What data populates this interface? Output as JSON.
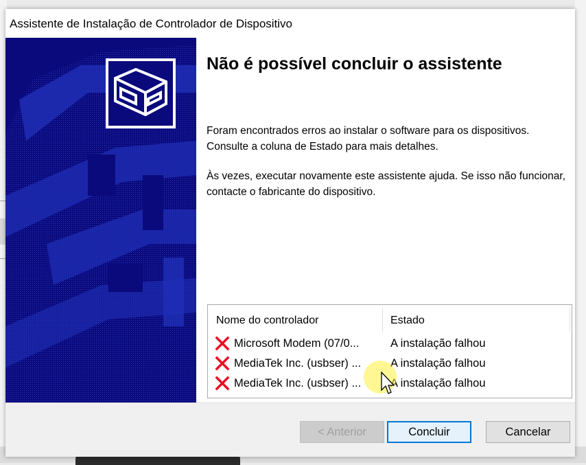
{
  "window": {
    "title": "Assistente de Instalação de Controlador de Dispositivo"
  },
  "banner": {
    "icon": "device-driver-icon"
  },
  "main": {
    "heading": "Não é possível concluir o assistente",
    "paragraph1": "Foram encontrados erros ao instalar o software para os dispositivos. Consulte a coluna de Estado para mais detalhes.",
    "paragraph2": "Às vezes, executar novamente este assistente ajuda. Se isso não funcionar, contacte o fabricante do dispositivo."
  },
  "driver_list": {
    "columns": [
      "Nome do controlador",
      "Estado"
    ],
    "rows": [
      {
        "name": "Microsoft Modem  (07/0...",
        "status": "A instalação falhou",
        "icon": "error-x-icon"
      },
      {
        "name": "MediaTek Inc. (usbser) ...",
        "status": "A instalação falhou",
        "icon": "error-x-icon"
      },
      {
        "name": "MediaTek Inc. (usbser) ...",
        "status": "A instalação falhou",
        "icon": "error-x-icon"
      }
    ]
  },
  "buttons": {
    "back": "< Anterior",
    "finish": "Concluir",
    "cancel": "Cancelar"
  },
  "colors": {
    "banner_bg": "#0a0a7c",
    "error_red": "#e81123",
    "focus_blue": "#0078d7"
  }
}
